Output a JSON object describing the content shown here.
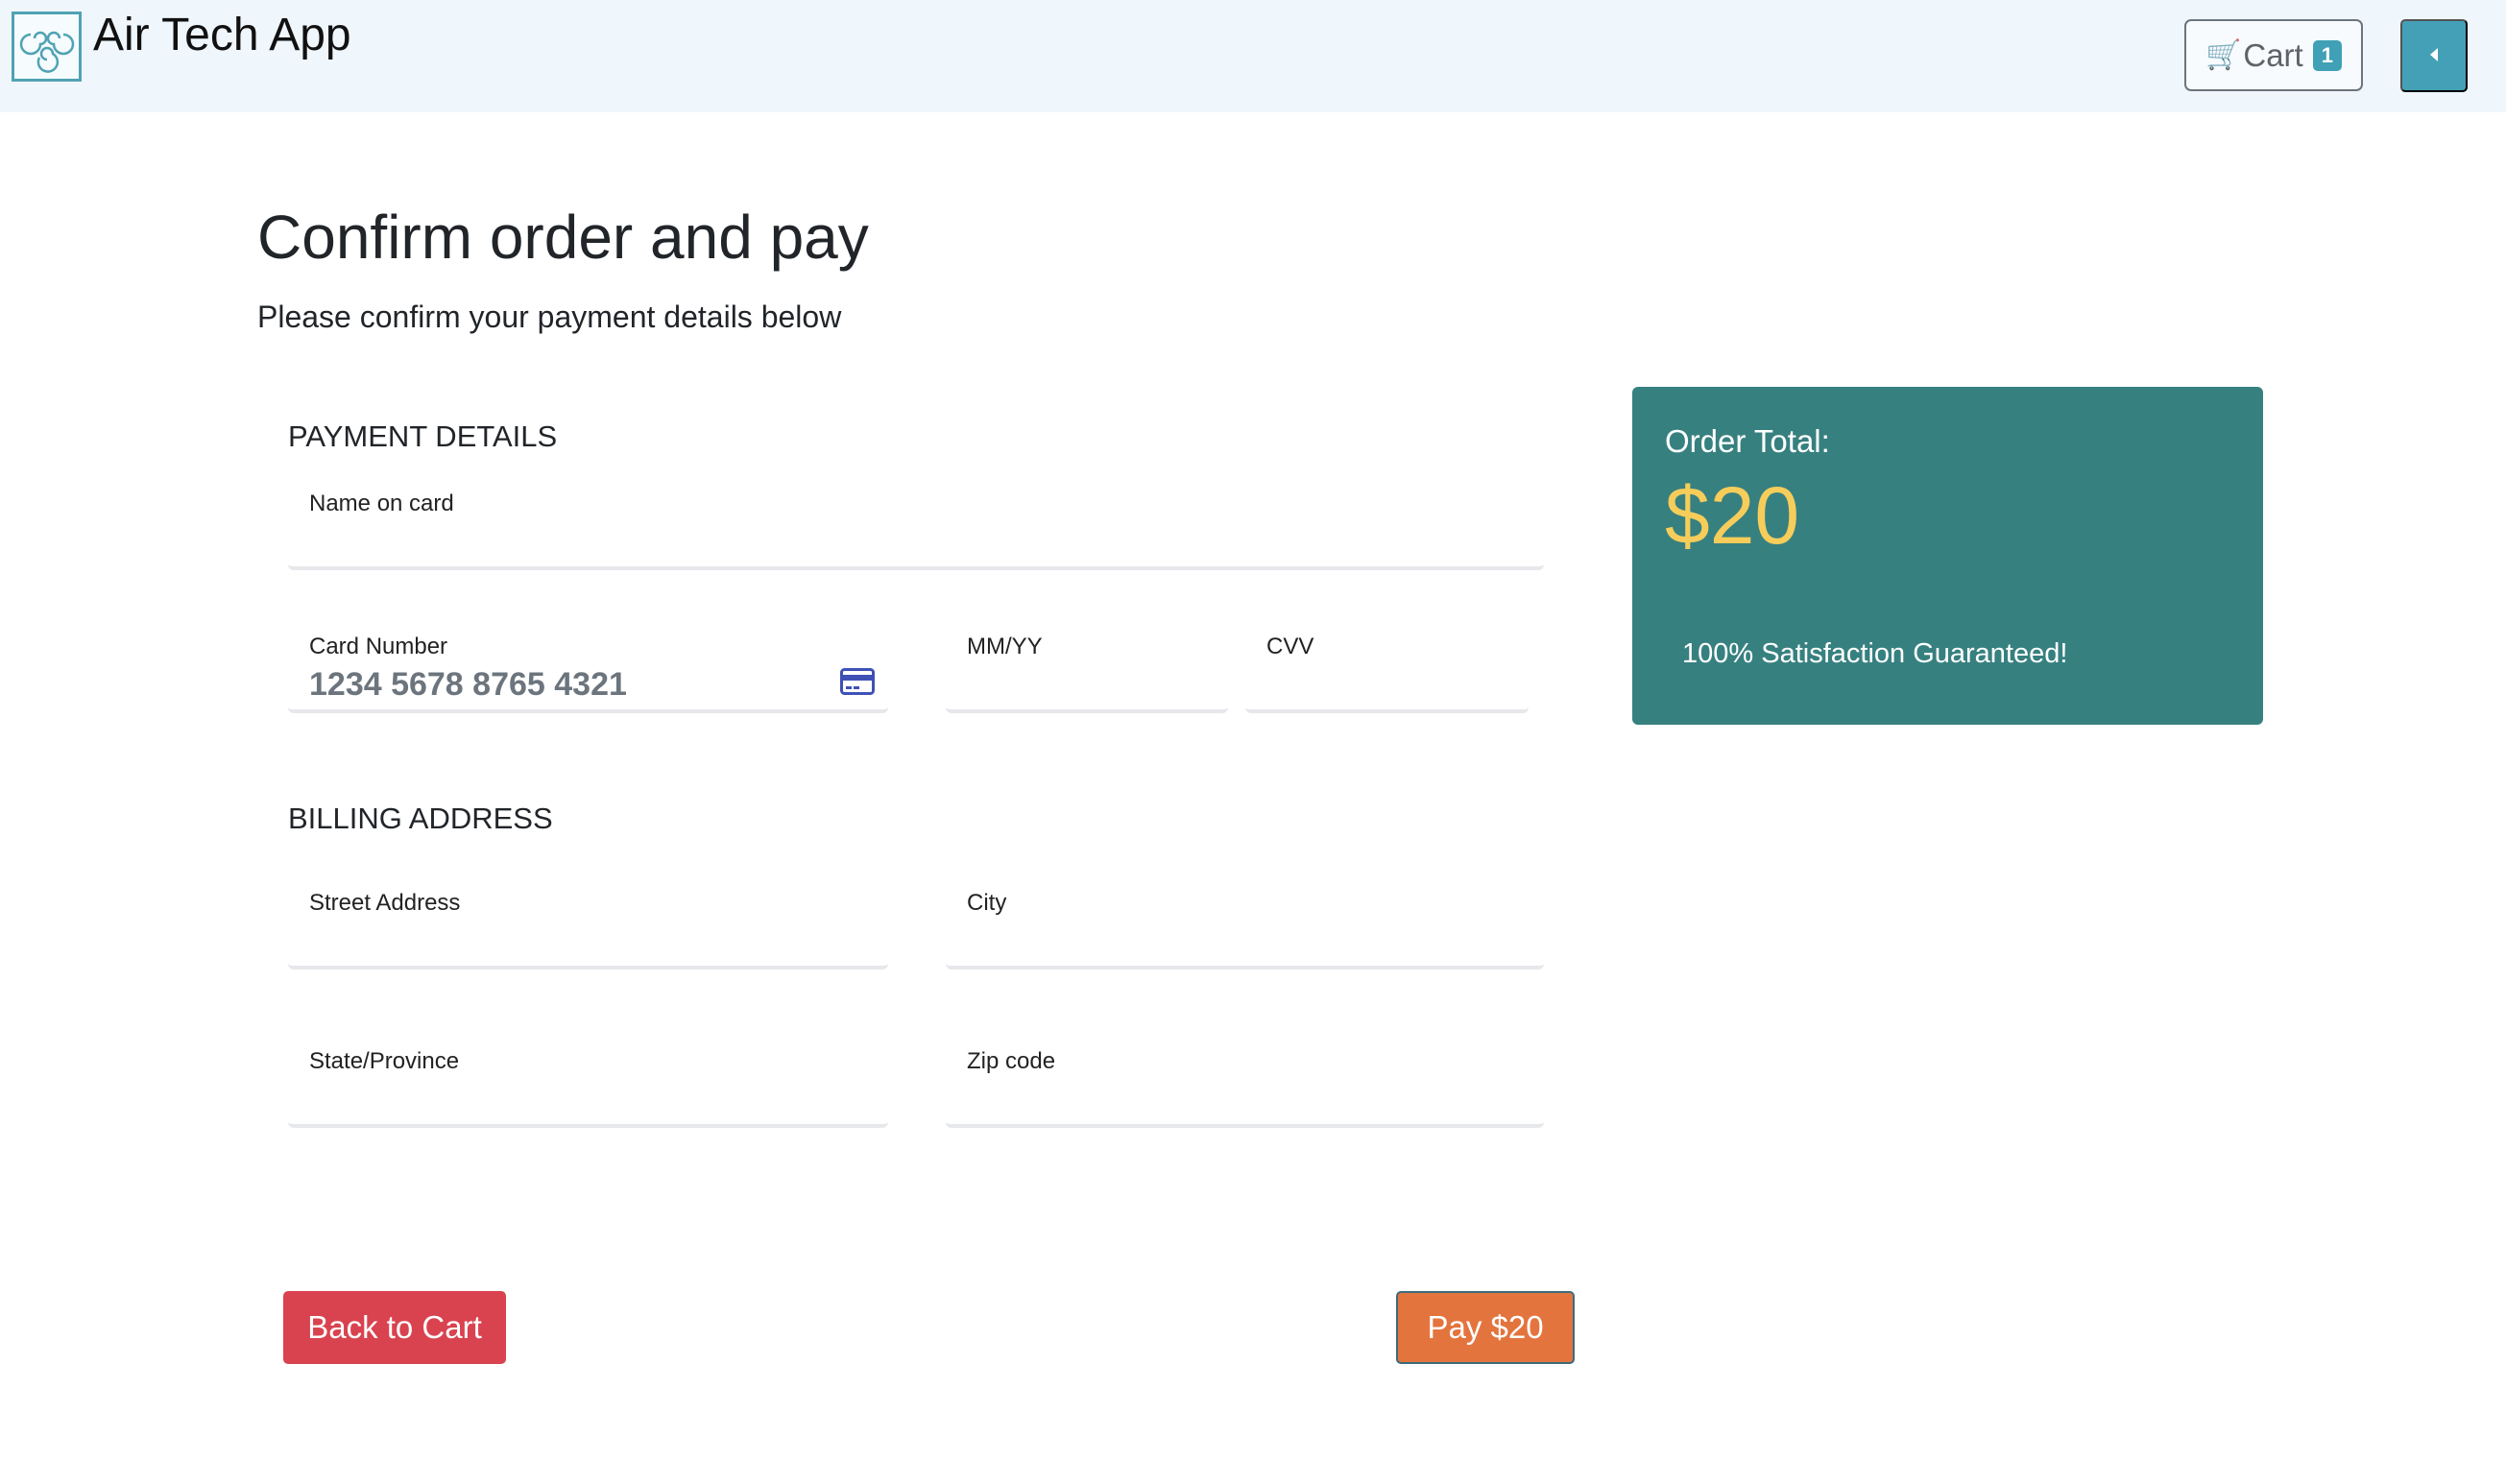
{
  "navbar": {
    "brand": "Air Tech App",
    "logo_icon": "air-swirl-logo",
    "cart_label": "Cart",
    "cart_icon": "shopping-cart-icon",
    "cart_count": "1",
    "toggle_icon": "caret-left-icon"
  },
  "page": {
    "title": "Confirm order and pay",
    "subtitle": "Please confirm your payment details below"
  },
  "payment": {
    "section_title": "PAYMENT DETAILS",
    "name_label": "Name on card",
    "card_label": "Card Number",
    "card_value": "1234 5678 8765 4321",
    "card_icon": "credit-card-icon",
    "expiry_label": "MM/YY",
    "cvv_label": "CVV"
  },
  "billing": {
    "section_title": "BILLING ADDRESS",
    "street_label": "Street Address",
    "city_label": "City",
    "state_label": "State/Province",
    "zip_label": "Zip code"
  },
  "order": {
    "label": "Order Total:",
    "amount": "$20",
    "guarantee": "100% Satisfaction Guaranteed!"
  },
  "actions": {
    "back_label": "Back to Cart",
    "pay_label": "Pay $20"
  },
  "colors": {
    "accent": "#44a0b6",
    "order_card": "#378080",
    "order_amount": "#f6cd5a",
    "back_button": "#d9434f",
    "pay_button": "#e4743d"
  }
}
